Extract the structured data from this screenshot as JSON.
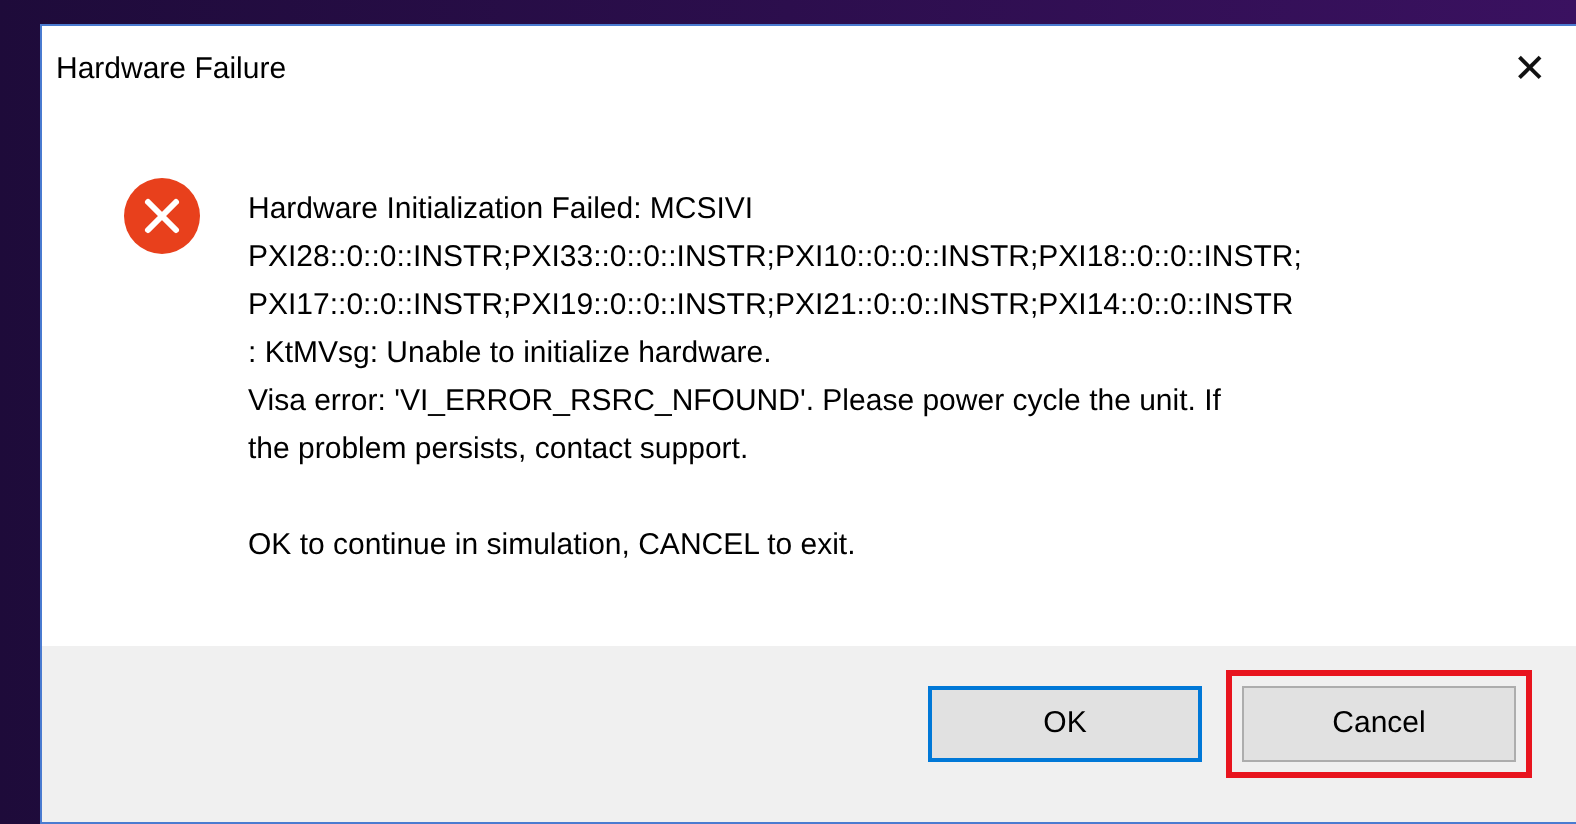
{
  "window": {
    "title": "Hardware Failure",
    "close": "✕"
  },
  "message": [
    {
      "lines": [
        "Hardware Initialization Failed: MCSIVI",
        "PXI28::0::0::INSTR;PXI33::0::0::INSTR;PXI10::0::0::INSTR;PXI18::0::0::INSTR;",
        "PXI17::0::0::INSTR;PXI19::0::0::INSTR;PXI21::0::0::INSTR;PXI14::0::0::INSTR",
        ": KtMVsg: Unable to initialize hardware.",
        "Visa error: 'VI_ERROR_RSRC_NFOUND'. Please power cycle the unit. If",
        "the problem persists, contact support."
      ]
    },
    {
      "lines": [
        "OK to continue in simulation, CANCEL to exit."
      ]
    }
  ],
  "buttons": [
    {
      "label": "OK",
      "focused": true,
      "highlighted": false
    },
    {
      "label": "Cancel",
      "focused": false,
      "highlighted": true
    }
  ]
}
